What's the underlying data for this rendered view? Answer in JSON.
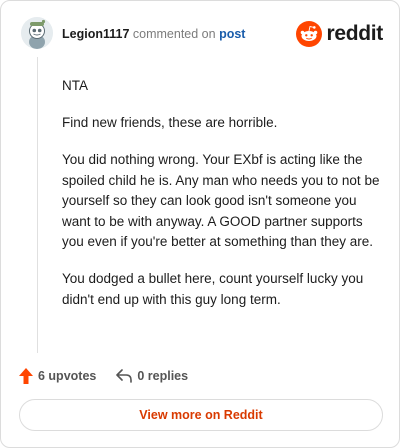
{
  "header": {
    "username": "Legion1117",
    "commented_text": "commented on",
    "post_link": "post",
    "brand": "reddit"
  },
  "comment": {
    "paragraphs": [
      "NTA",
      "Find new friends, these are horrible.",
      "You did nothing wrong. Your EXbf is acting like the spoiled child he is. Any man who needs you to not be yourself so they can look good isn't someone you want to be with anyway. A GOOD partner supports you even if you're better at something than they are.",
      "You dodged a bullet here, count yourself lucky you didn't end up with this guy long term."
    ]
  },
  "actions": {
    "upvotes": "6 upvotes",
    "replies": "0 replies"
  },
  "footer": {
    "view_more": "View more on Reddit"
  },
  "colors": {
    "brand_orange": "#ff4500",
    "link_blue": "#1a5dab",
    "view_more_text": "#d93a00"
  },
  "icons": {
    "avatar": "snoo-avatar",
    "logo": "reddit-snoo-icon",
    "upvote": "upvote-arrow-icon",
    "reply": "reply-arrow-icon"
  }
}
